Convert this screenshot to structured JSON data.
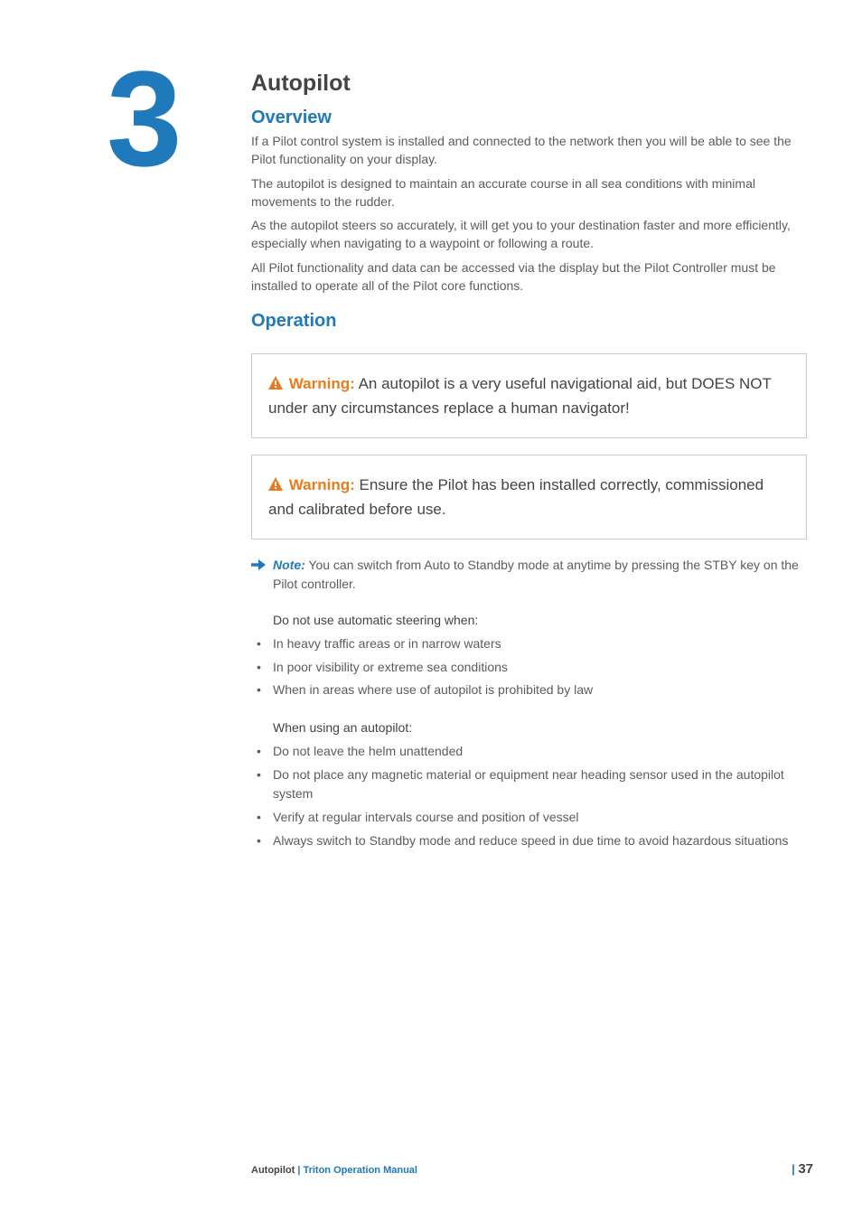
{
  "chapter_number": "3",
  "title": "Autopilot",
  "overview": {
    "heading": "Overview",
    "p1": "If a Pilot control system is installed and connected to the network then you will be able to see the Pilot functionality on your display.",
    "p2": "The autopilot is designed to maintain an accurate course in all sea conditions with minimal movements to the rudder.",
    "p3": "As the autopilot steers so accurately, it will get you to your destination faster and more efficiently, especially when navigating to a waypoint or following a route.",
    "p4": "All Pilot functionality and data can be accessed via the display but the Pilot Controller must be installed to operate all of the Pilot core functions."
  },
  "operation": {
    "heading": "Operation",
    "warning_label": "Warning:",
    "warning1": "An autopilot is a very useful navigational aid, but DOES NOT under any circumstances replace a human navigator!",
    "warning2": "Ensure the Pilot has been installed correctly, commissioned and calibrated before use.",
    "note_label": "Note:",
    "note_text": "You can switch from Auto to Standby mode at anytime by pressing the STBY key on the Pilot controller.",
    "list1_heading": "Do not use automatic steering when:",
    "list1": [
      "In heavy traffic areas or in narrow waters",
      "In poor visibility or extreme sea conditions",
      "When in areas where use of autopilot is prohibited by law"
    ],
    "list2_heading": "When using an autopilot:",
    "list2": [
      "Do not leave the helm unattended",
      "Do not place any magnetic material or equipment near heading sensor used in the autopilot system",
      "Verify at regular intervals course and position of vessel",
      "Always switch to Standby mode and reduce speed in due time to avoid hazardous situations"
    ]
  },
  "footer": {
    "section": "Autopilot",
    "sep": " | ",
    "manual": "Triton Operation Manual",
    "page_sep": "| ",
    "page": "37"
  }
}
